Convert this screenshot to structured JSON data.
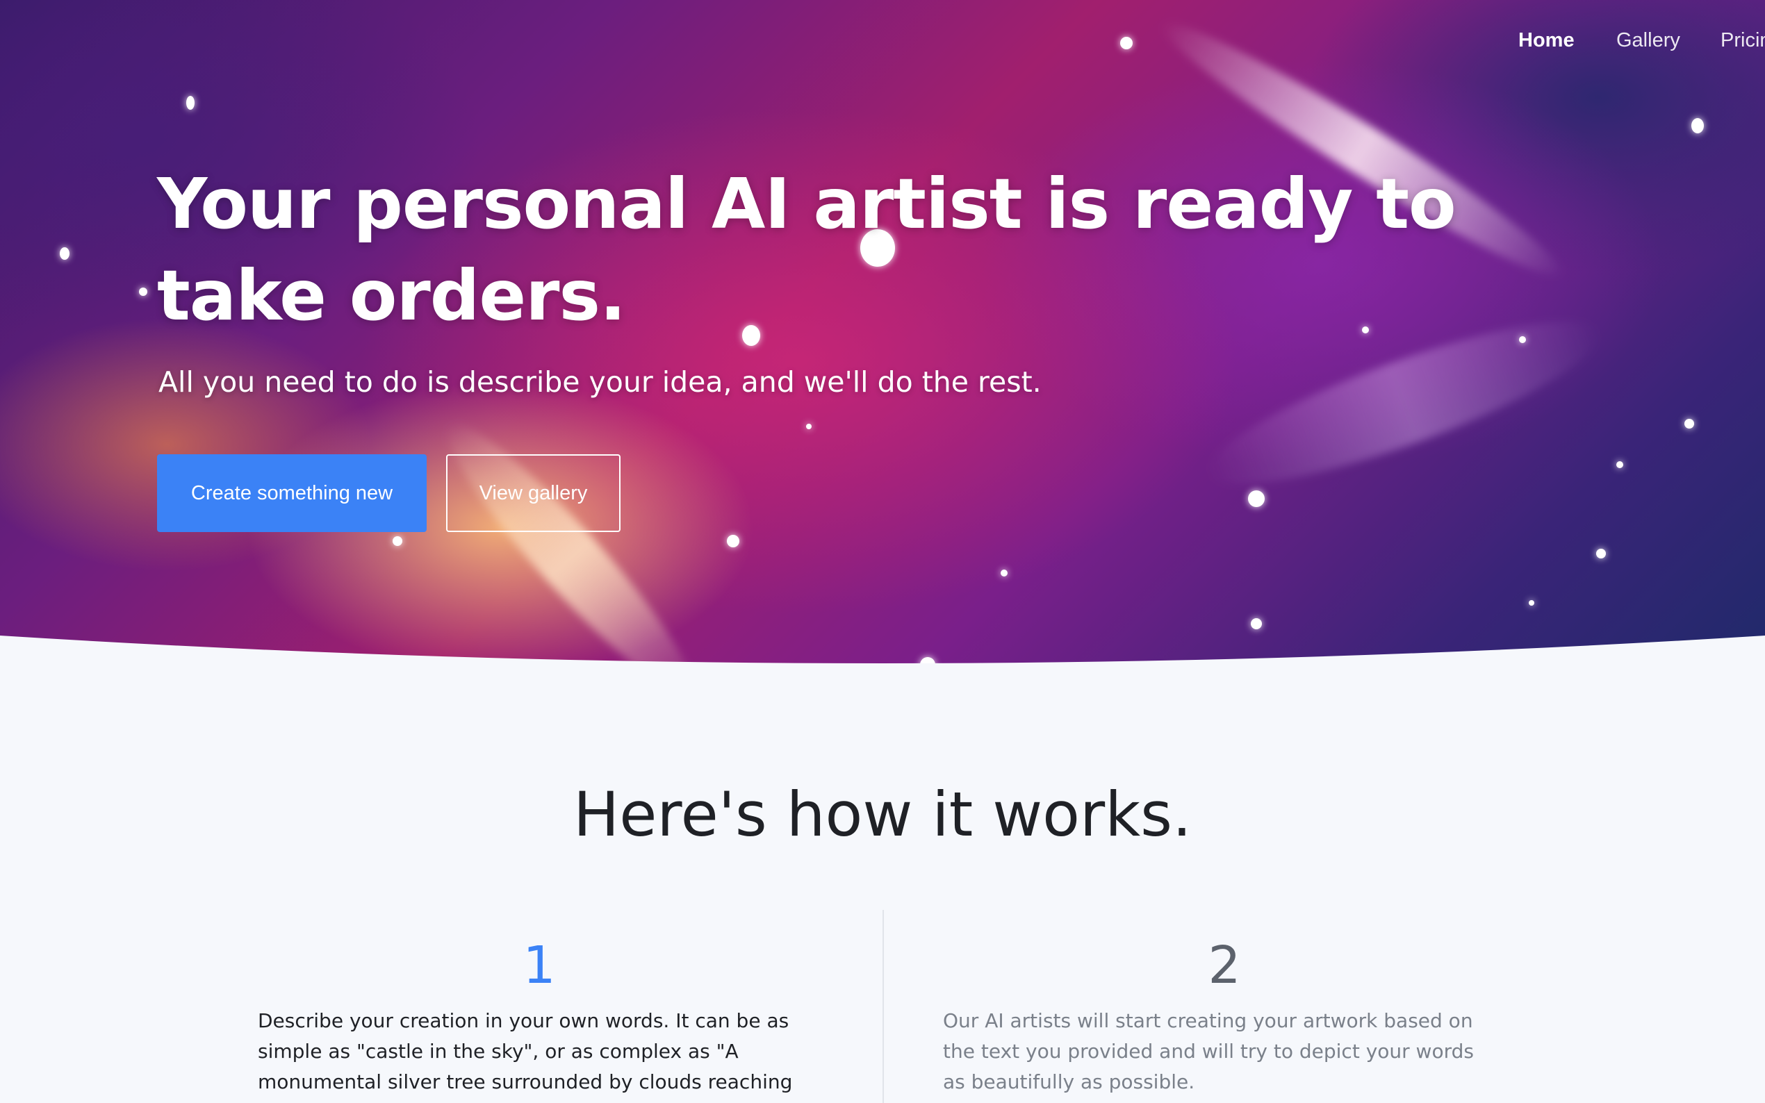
{
  "nav": {
    "items": [
      {
        "label": "Home",
        "active": true
      },
      {
        "label": "Gallery",
        "active": false
      },
      {
        "label": "Pricing",
        "active": false
      }
    ]
  },
  "hero": {
    "title": "Your personal AI artist is ready to take orders.",
    "subtitle": "All you need to do is describe your idea, and we'll do the rest.",
    "primary_button": "Create something new",
    "secondary_button": "View gallery"
  },
  "how_it_works": {
    "title": "Here's how it works.",
    "steps": [
      {
        "number": "1",
        "text": "Describe your creation in your own words. It can be as simple as \"castle in the sky\", or as complex as \"A monumental silver tree surrounded by clouds reaching the",
        "highlighted": true
      },
      {
        "number": "2",
        "text": "Our AI artists will start creating your artwork based on the text you provided and will try to depict your words as beautifully as possible.",
        "highlighted": false
      }
    ]
  },
  "colors": {
    "accent": "#3b82f6",
    "page_background": "#f6f8fc",
    "heading": "#1f2126",
    "muted_text": "#7a808a"
  }
}
